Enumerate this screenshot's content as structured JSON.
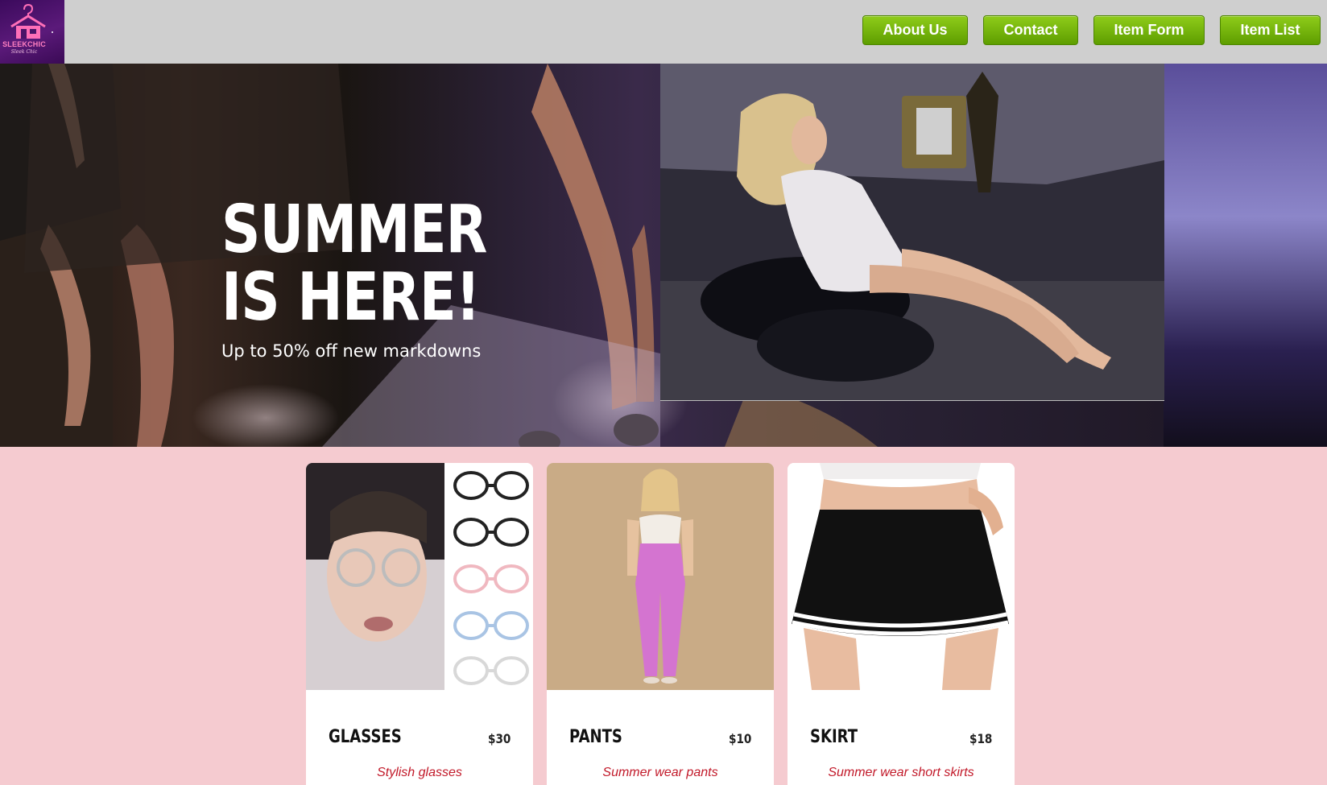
{
  "header": {
    "logo": {
      "name": "SLEEKCHIC",
      "tagline": "Sleek Chic"
    },
    "nav": [
      {
        "label": "About Us"
      },
      {
        "label": "Contact"
      },
      {
        "label": "Item Form"
      },
      {
        "label": "Item List"
      }
    ],
    "colors": {
      "bar": "#cfcfcf",
      "button": "#6fb30a",
      "logo_bg": "#4a1468"
    }
  },
  "hero": {
    "title": "SUMMER IS HERE!",
    "subtitle": "Up to 50% off new markdowns"
  },
  "products": [
    {
      "name": "GLASSES",
      "price": "$30",
      "description": "Stylish glasses"
    },
    {
      "name": "PANTS",
      "price": "$10",
      "description": "Summer wear pants"
    },
    {
      "name": "SKIRT",
      "price": "$18",
      "description": "Summer wear short skirts"
    }
  ],
  "colors": {
    "page_bg": "#f5cbd0",
    "description_text": "#c21a2a"
  }
}
